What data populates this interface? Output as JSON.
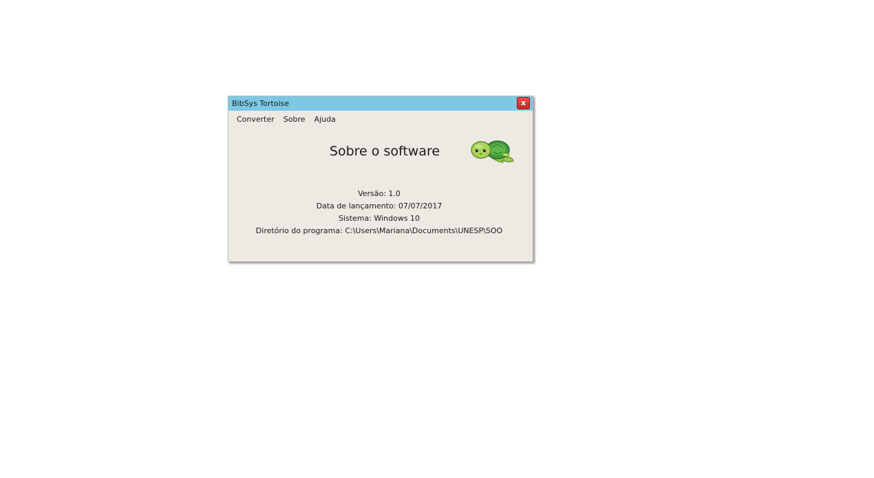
{
  "window": {
    "title": "BibSys Tortoise",
    "close_label": "x"
  },
  "menu": {
    "items": [
      "Converter",
      "Sobre",
      "Ajuda"
    ]
  },
  "about": {
    "heading": "Sobre o software",
    "version": "Versão: 1.0",
    "release_date": "Data de lançamento: 07/07/2017",
    "system": "Sistema: Windows 10",
    "directory": "Diretório do programa: C:\\Users\\Mariana\\Documents\\UNESP\\SOO"
  },
  "icons": {
    "mascot": "turtle-icon"
  },
  "colors": {
    "titlebar": "#7ec8e3",
    "window_bg": "#ede9e3",
    "close_button": "#d93a31"
  }
}
